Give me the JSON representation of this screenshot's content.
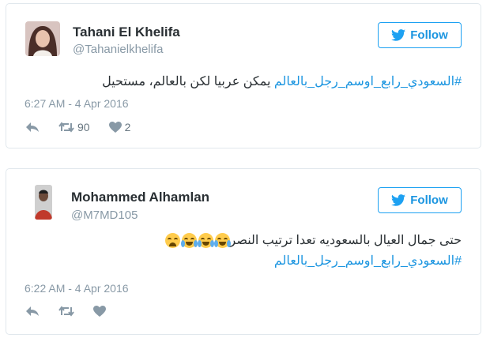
{
  "tweets": [
    {
      "name": "Tahani El Khelifa",
      "handle": "@Tahanielkhelifa",
      "follow_label": "Follow",
      "hashtag": "#السعودي_رابع_اوسم_رجل_بالعالم",
      "text": " يمكن عربيا لكن بالعالم، مستحيل",
      "date": "6:27 AM - 4 Apr 2016",
      "retweets": "90",
      "likes": "2"
    },
    {
      "name": "Mohammed Alhamlan",
      "handle": "@M7MD105",
      "follow_label": "Follow",
      "text": "حتى جمال العيال بالسعوديه تعدا ترتيب النصر",
      "hashtag": "#السعودي_رابع_اوسم_رجل_بالعالم",
      "date": "6:22 AM - 4 Apr 2016",
      "emojis": [
        "face-with-tears-of-joy",
        "face-with-tears-of-joy",
        "face-with-tears-of-joy",
        "tired-face"
      ]
    }
  ],
  "colors": {
    "link": "#1b95e0",
    "follow_border": "#1da1f2",
    "meta": "#8899a6"
  }
}
